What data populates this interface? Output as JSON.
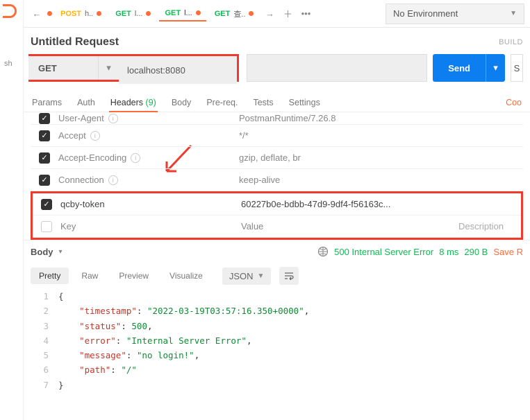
{
  "env": {
    "selected": "No Environment"
  },
  "tabs": [
    {
      "method": "POST",
      "label": "h..",
      "cls": "POST"
    },
    {
      "method": "GET",
      "label": "l...",
      "cls": "GET"
    },
    {
      "method": "GET",
      "label": "l...",
      "cls": "GET",
      "active": true
    },
    {
      "method": "GET",
      "label": "查..",
      "cls": "GET"
    }
  ],
  "request": {
    "title": "Untitled Request",
    "build_label": "BUILD",
    "method": "GET",
    "url": "localhost:8080",
    "send_label": "Send"
  },
  "req_tabs": {
    "params": "Params",
    "auth": "Auth",
    "headers": "Headers",
    "headers_count": "(9)",
    "body": "Body",
    "prereq": "Pre-req.",
    "tests": "Tests",
    "settings": "Settings",
    "cookies": "Coo"
  },
  "headers": {
    "partial_key": "User-Agent",
    "partial_val": "PostmanRuntime/7.26.8",
    "rows": [
      {
        "key": "Accept",
        "value": "*/*",
        "sys": true
      },
      {
        "key": "Accept-Encoding",
        "value": "gzip, deflate, br",
        "sys": true
      },
      {
        "key": "Connection",
        "value": "keep-alive",
        "sys": true
      },
      {
        "key": "qcby-token",
        "value": "60227b0e-bdbb-47d9-9df4-f56163c...",
        "sys": false
      }
    ],
    "placeholder_key": "Key",
    "placeholder_value": "Value",
    "placeholder_desc": "Description"
  },
  "response": {
    "body_label": "Body",
    "status": "500 Internal Server Error",
    "time": "8 ms",
    "size": "290 B",
    "save": "Save R",
    "views": {
      "pretty": "Pretty",
      "raw": "Raw",
      "preview": "Preview",
      "visualize": "Visualize",
      "format": "JSON"
    }
  },
  "body_lines": [
    "{",
    "    \"timestamp\": \"2022-03-19T03:57:16.350+0000\",",
    "    \"status\": 500,",
    "    \"error\": \"Internal Server Error\",",
    "    \"message\": \"no login!\",",
    "    \"path\": \"/\"",
    "}"
  ],
  "chart_data": {
    "type": "table",
    "title": "Response JSON body",
    "rows": [
      {
        "key": "timestamp",
        "value": "2022-03-19T03:57:16.350+0000"
      },
      {
        "key": "status",
        "value": 500
      },
      {
        "key": "error",
        "value": "Internal Server Error"
      },
      {
        "key": "message",
        "value": "no login!"
      },
      {
        "key": "path",
        "value": "/"
      }
    ]
  }
}
